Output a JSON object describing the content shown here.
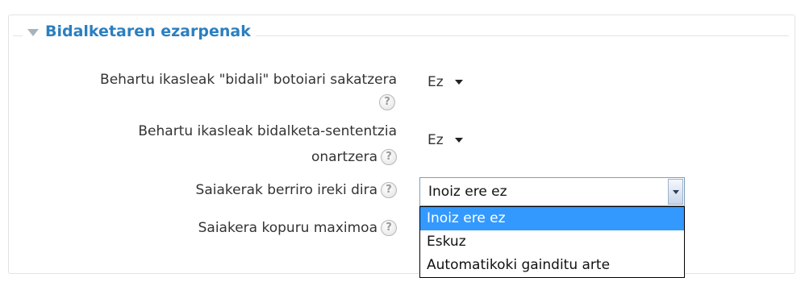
{
  "section": {
    "title": "Bidalketaren ezarpenak",
    "collapse_icon": "triangle-down-icon"
  },
  "fields": [
    {
      "label_line1": "Behartu ikasleak \"bidali\" botoiari sakatzera",
      "help_icon": "help-icon",
      "value": "Ez"
    },
    {
      "label_line1": "Behartu ikasleak bidalketa-sententzia",
      "label_line2": "onartzera",
      "help_icon": "help-icon",
      "value": "Ez"
    },
    {
      "label": "Saiakerak berriro ireki dira",
      "help_icon": "help-icon",
      "value": "Inoiz ere ez",
      "options": [
        "Inoiz ere ez",
        "Eskuz",
        "Automatikoki gainditu arte"
      ],
      "highlighted_option": "Inoiz ere ez"
    },
    {
      "label": "Saiakera kopuru maximoa",
      "help_icon": "help-icon"
    }
  ],
  "help_glyph": "?",
  "colors": {
    "legend_title": "#2b7fc0",
    "highlight": "#3399ff",
    "fieldset_border": "#e3e3e3"
  }
}
